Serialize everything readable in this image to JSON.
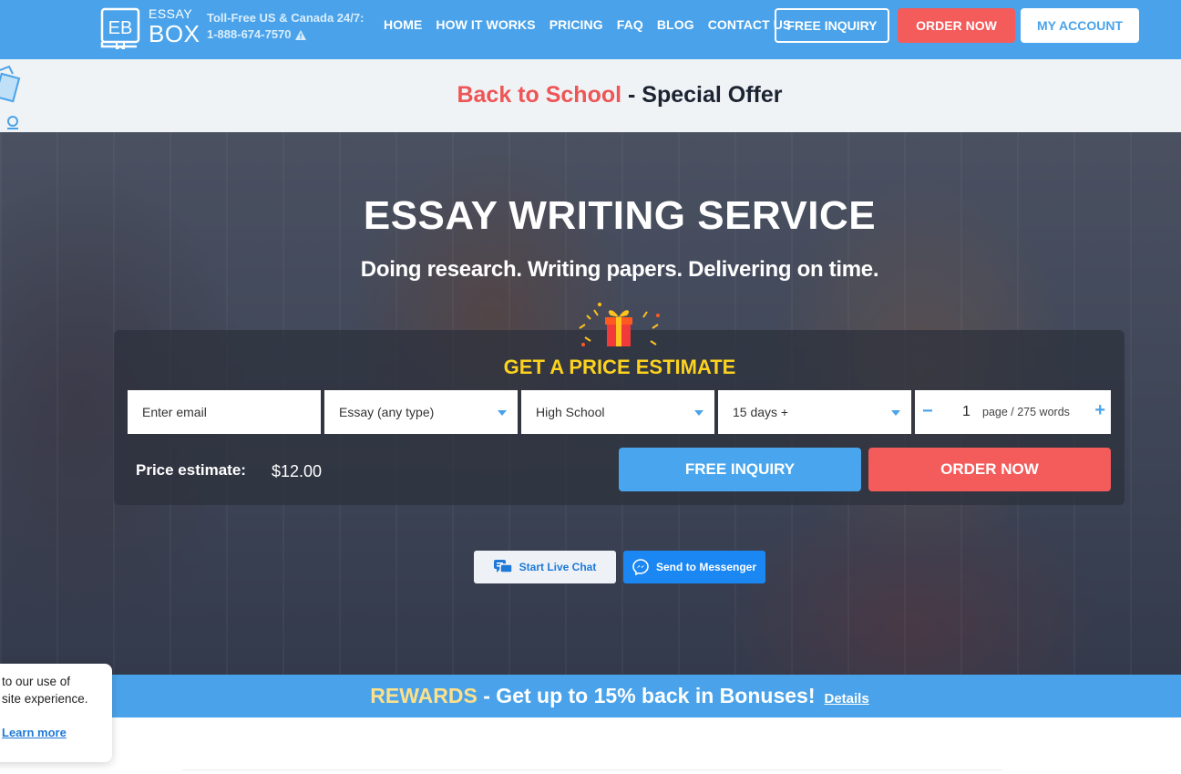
{
  "header": {
    "logo": {
      "monogram": "EB",
      "line1": "ESSAY",
      "line2": "BOX"
    },
    "tollfree_label": "Toll-Free US & Canada 24/7:",
    "phone": "1-888-674-7570",
    "nav": [
      "HOME",
      "HOW IT WORKS",
      "PRICING",
      "FAQ",
      "BLOG",
      "CONTACT US"
    ],
    "free_inquiry": "FREE INQUIRY",
    "order_now": "ORDER NOW",
    "my_account": "MY ACCOUNT"
  },
  "offer": {
    "highlight": "Back to School",
    "separator": " - ",
    "text": "Special Offer"
  },
  "hero": {
    "title": "ESSAY WRITING SERVICE",
    "subtitle": "Doing research. Writing papers. Delivering on time."
  },
  "estimate": {
    "title": "GET A PRICE ESTIMATE",
    "email_placeholder": "Enter email",
    "paper_type": "Essay (any type)",
    "academic_level": "High School",
    "deadline": "15 days +",
    "pages_minus": "−",
    "pages": "1",
    "pages_words": "page / 275 words",
    "pages_plus": "+",
    "price_label": "Price estimate:",
    "price_value": "$12.00",
    "free_inquiry": "FREE INQUIRY",
    "order_now": "ORDER NOW"
  },
  "chat": {
    "live": "Start Live Chat",
    "messenger": "Send to Messenger"
  },
  "rewards": {
    "highlight": "REWARDS",
    "text": " - Get up to 15% back in Bonuses!",
    "details": "Details"
  },
  "cookie": {
    "line1": "to our use of",
    "line2": "site experience.",
    "link": "Learn more"
  },
  "colors": {
    "brand_blue": "#4aa3ea",
    "order_red": "#f45b5b",
    "estimate_yellow": "#fcd21f",
    "rewards_gold": "#fde08a"
  }
}
